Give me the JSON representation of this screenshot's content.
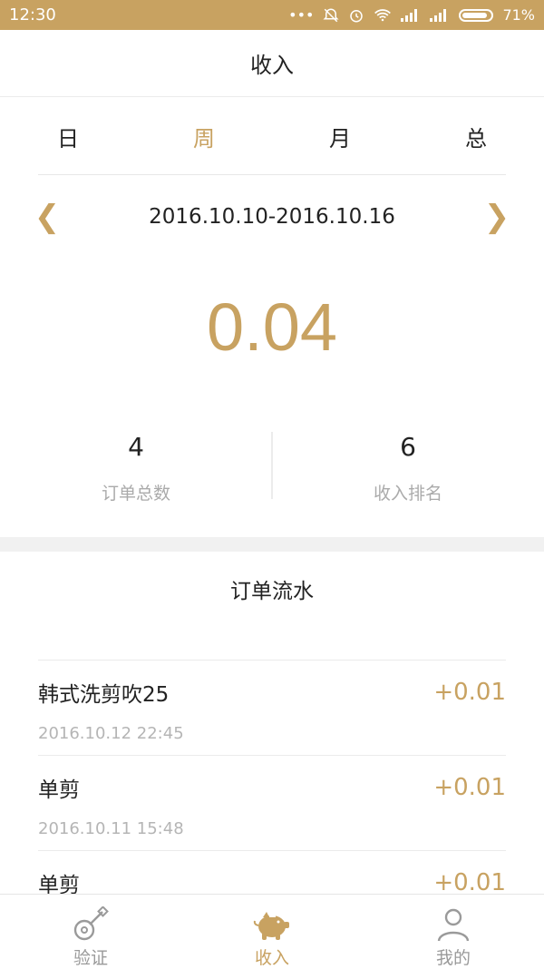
{
  "status_bar": {
    "time": "12:30",
    "battery": "71%"
  },
  "header": {
    "title": "收入"
  },
  "tabs": [
    {
      "label": "日",
      "active": false
    },
    {
      "label": "周",
      "active": true
    },
    {
      "label": "月",
      "active": false
    },
    {
      "label": "总",
      "active": false
    }
  ],
  "range": {
    "prev": "❮",
    "text": "2016.10.10-2016.10.16",
    "next": "❯"
  },
  "summary": {
    "amount": "0.04"
  },
  "stats": [
    {
      "value": "4",
      "label": "订单总数"
    },
    {
      "value": "6",
      "label": "收入排名"
    }
  ],
  "orders_section": {
    "title": "订单流水"
  },
  "orders": [
    {
      "name": "韩式洗剪吹25",
      "time": "2016.10.12 22:45",
      "amount": "+0.01"
    },
    {
      "name": "单剪",
      "time": "2016.10.11 15:48",
      "amount": "+0.01"
    },
    {
      "name": "单剪",
      "time": "",
      "amount": "+0.01"
    }
  ],
  "bottom_nav": [
    {
      "label": "验证",
      "icon": "guitar-icon",
      "active": false
    },
    {
      "label": "收入",
      "icon": "piggy-bank-icon",
      "active": true
    },
    {
      "label": "我的",
      "icon": "user-icon",
      "active": false
    }
  ],
  "colors": {
    "accent": "#c8a261",
    "text": "#222222",
    "muted": "#aaaaaa"
  }
}
